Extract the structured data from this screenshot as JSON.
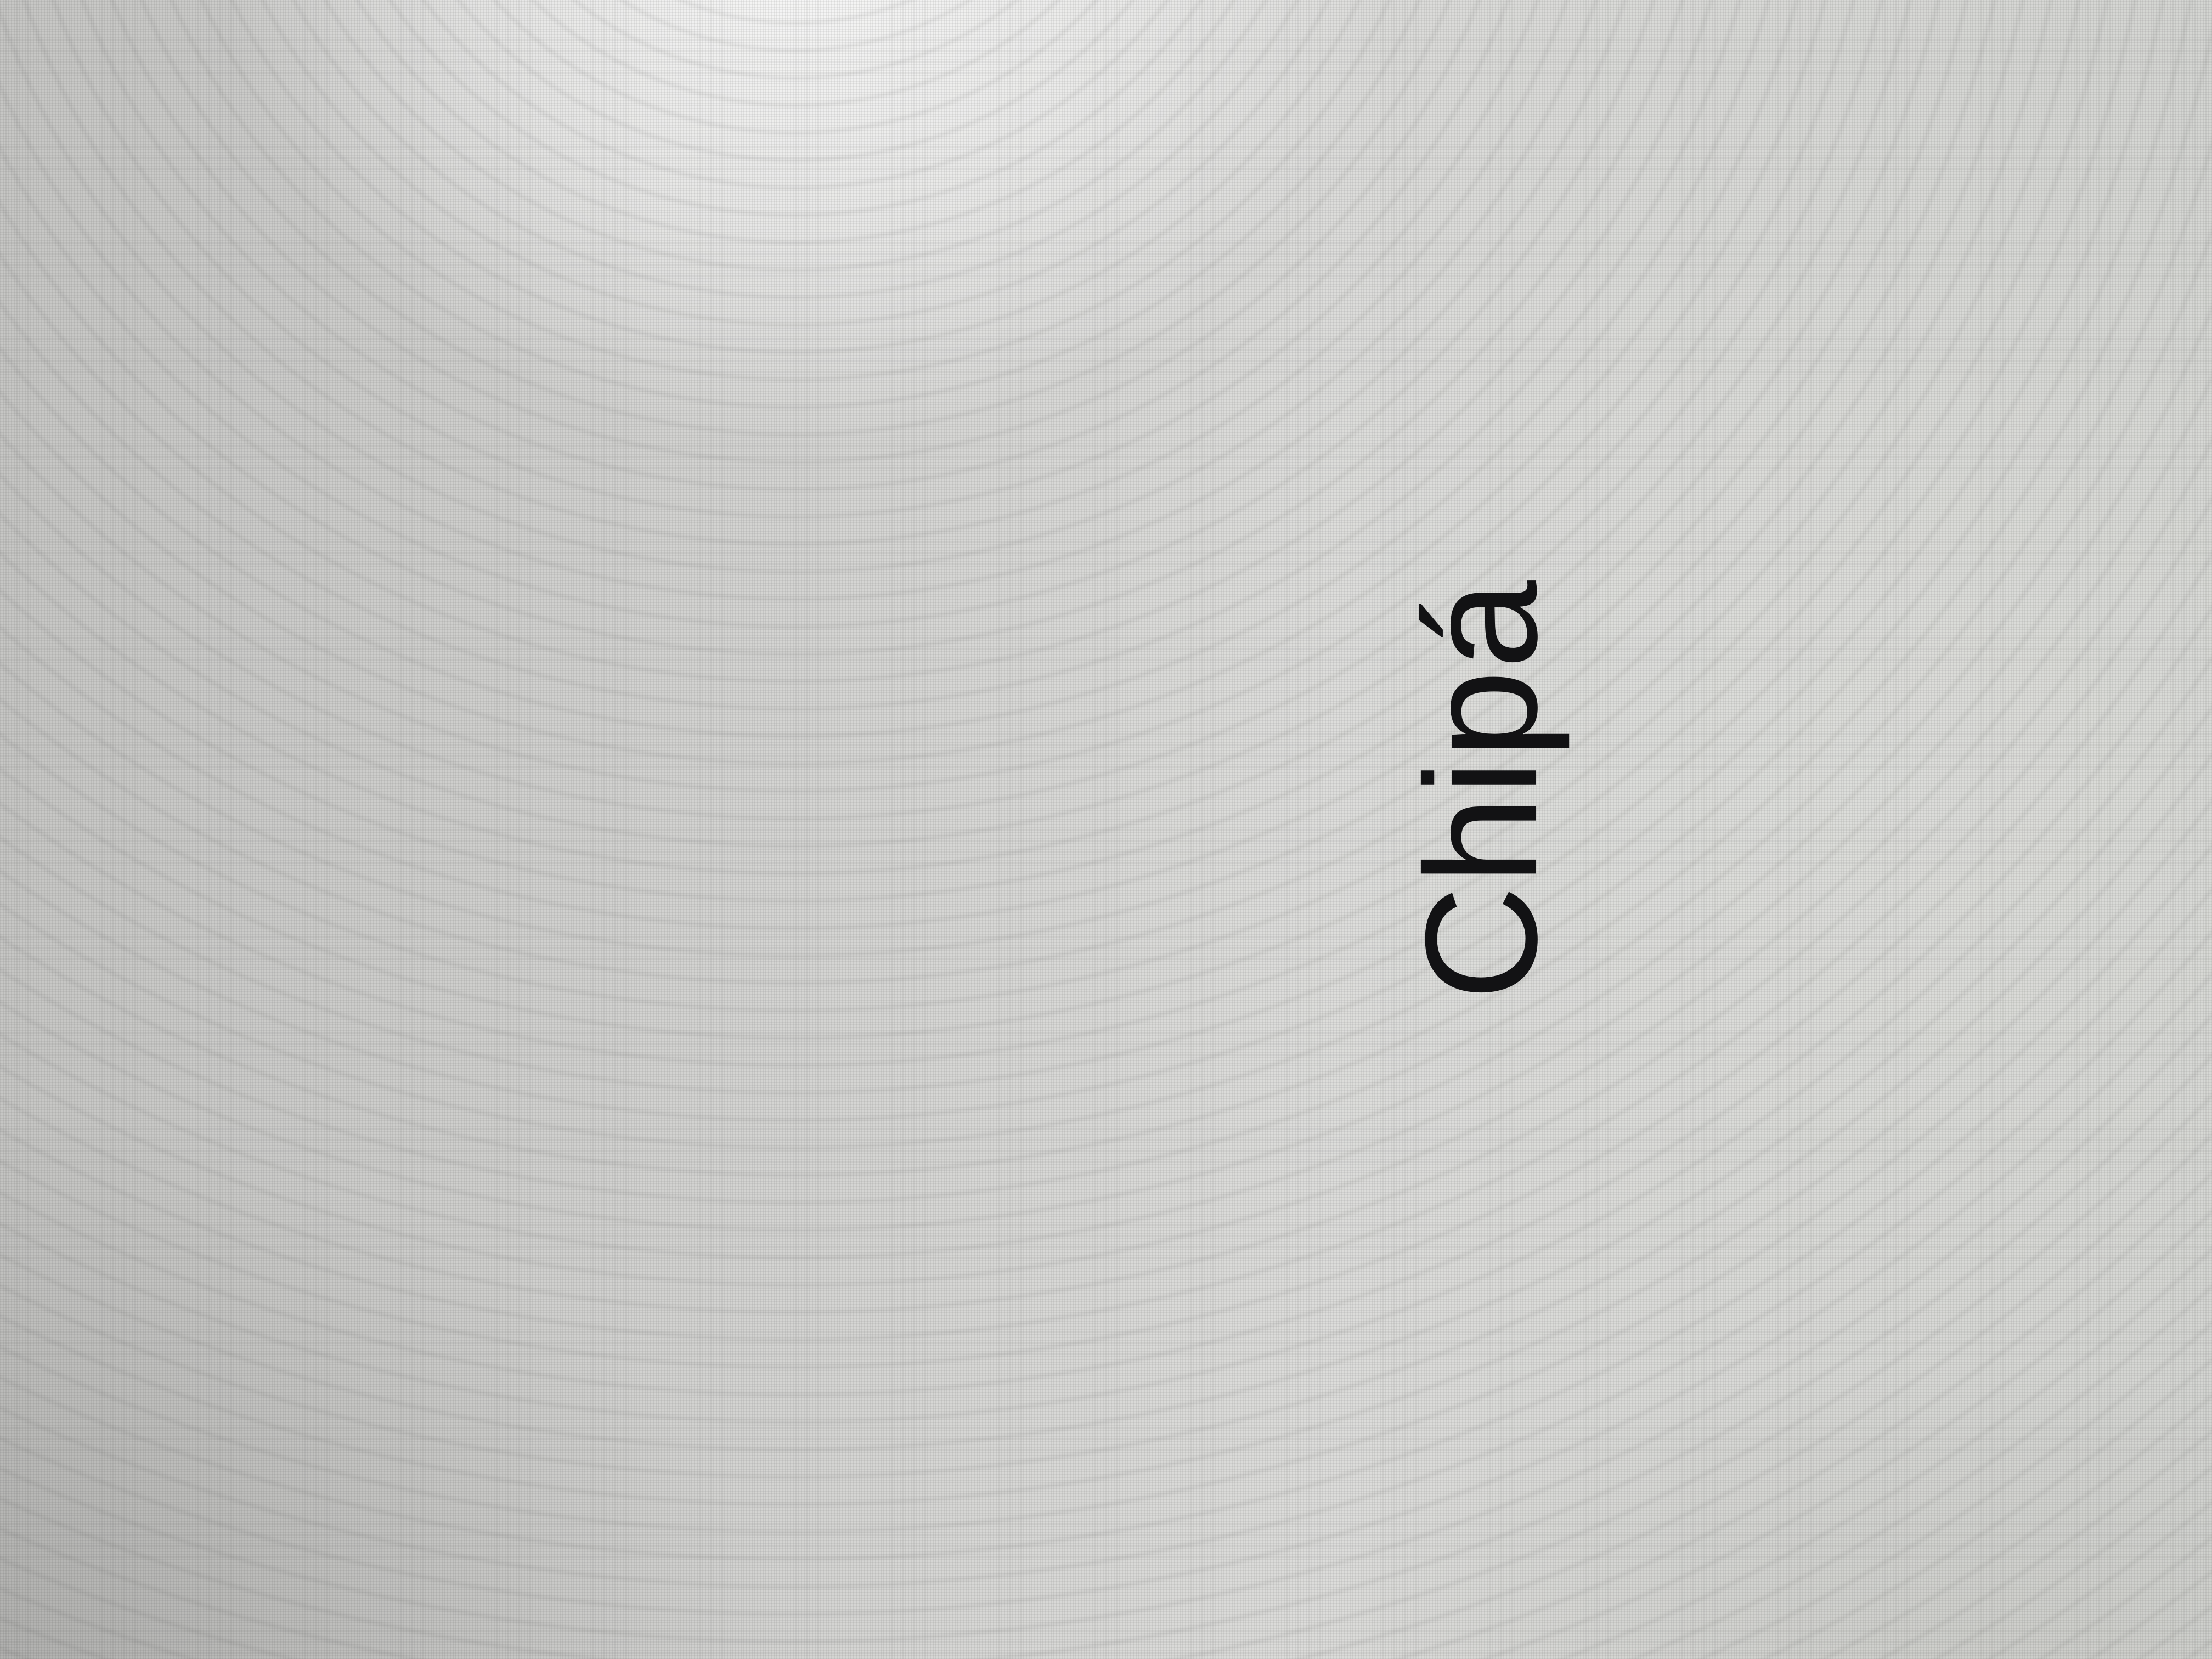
{
  "screen": {
    "label": "Chipá"
  },
  "colors": {
    "background": "#d3d3d1",
    "text": "#121214"
  }
}
